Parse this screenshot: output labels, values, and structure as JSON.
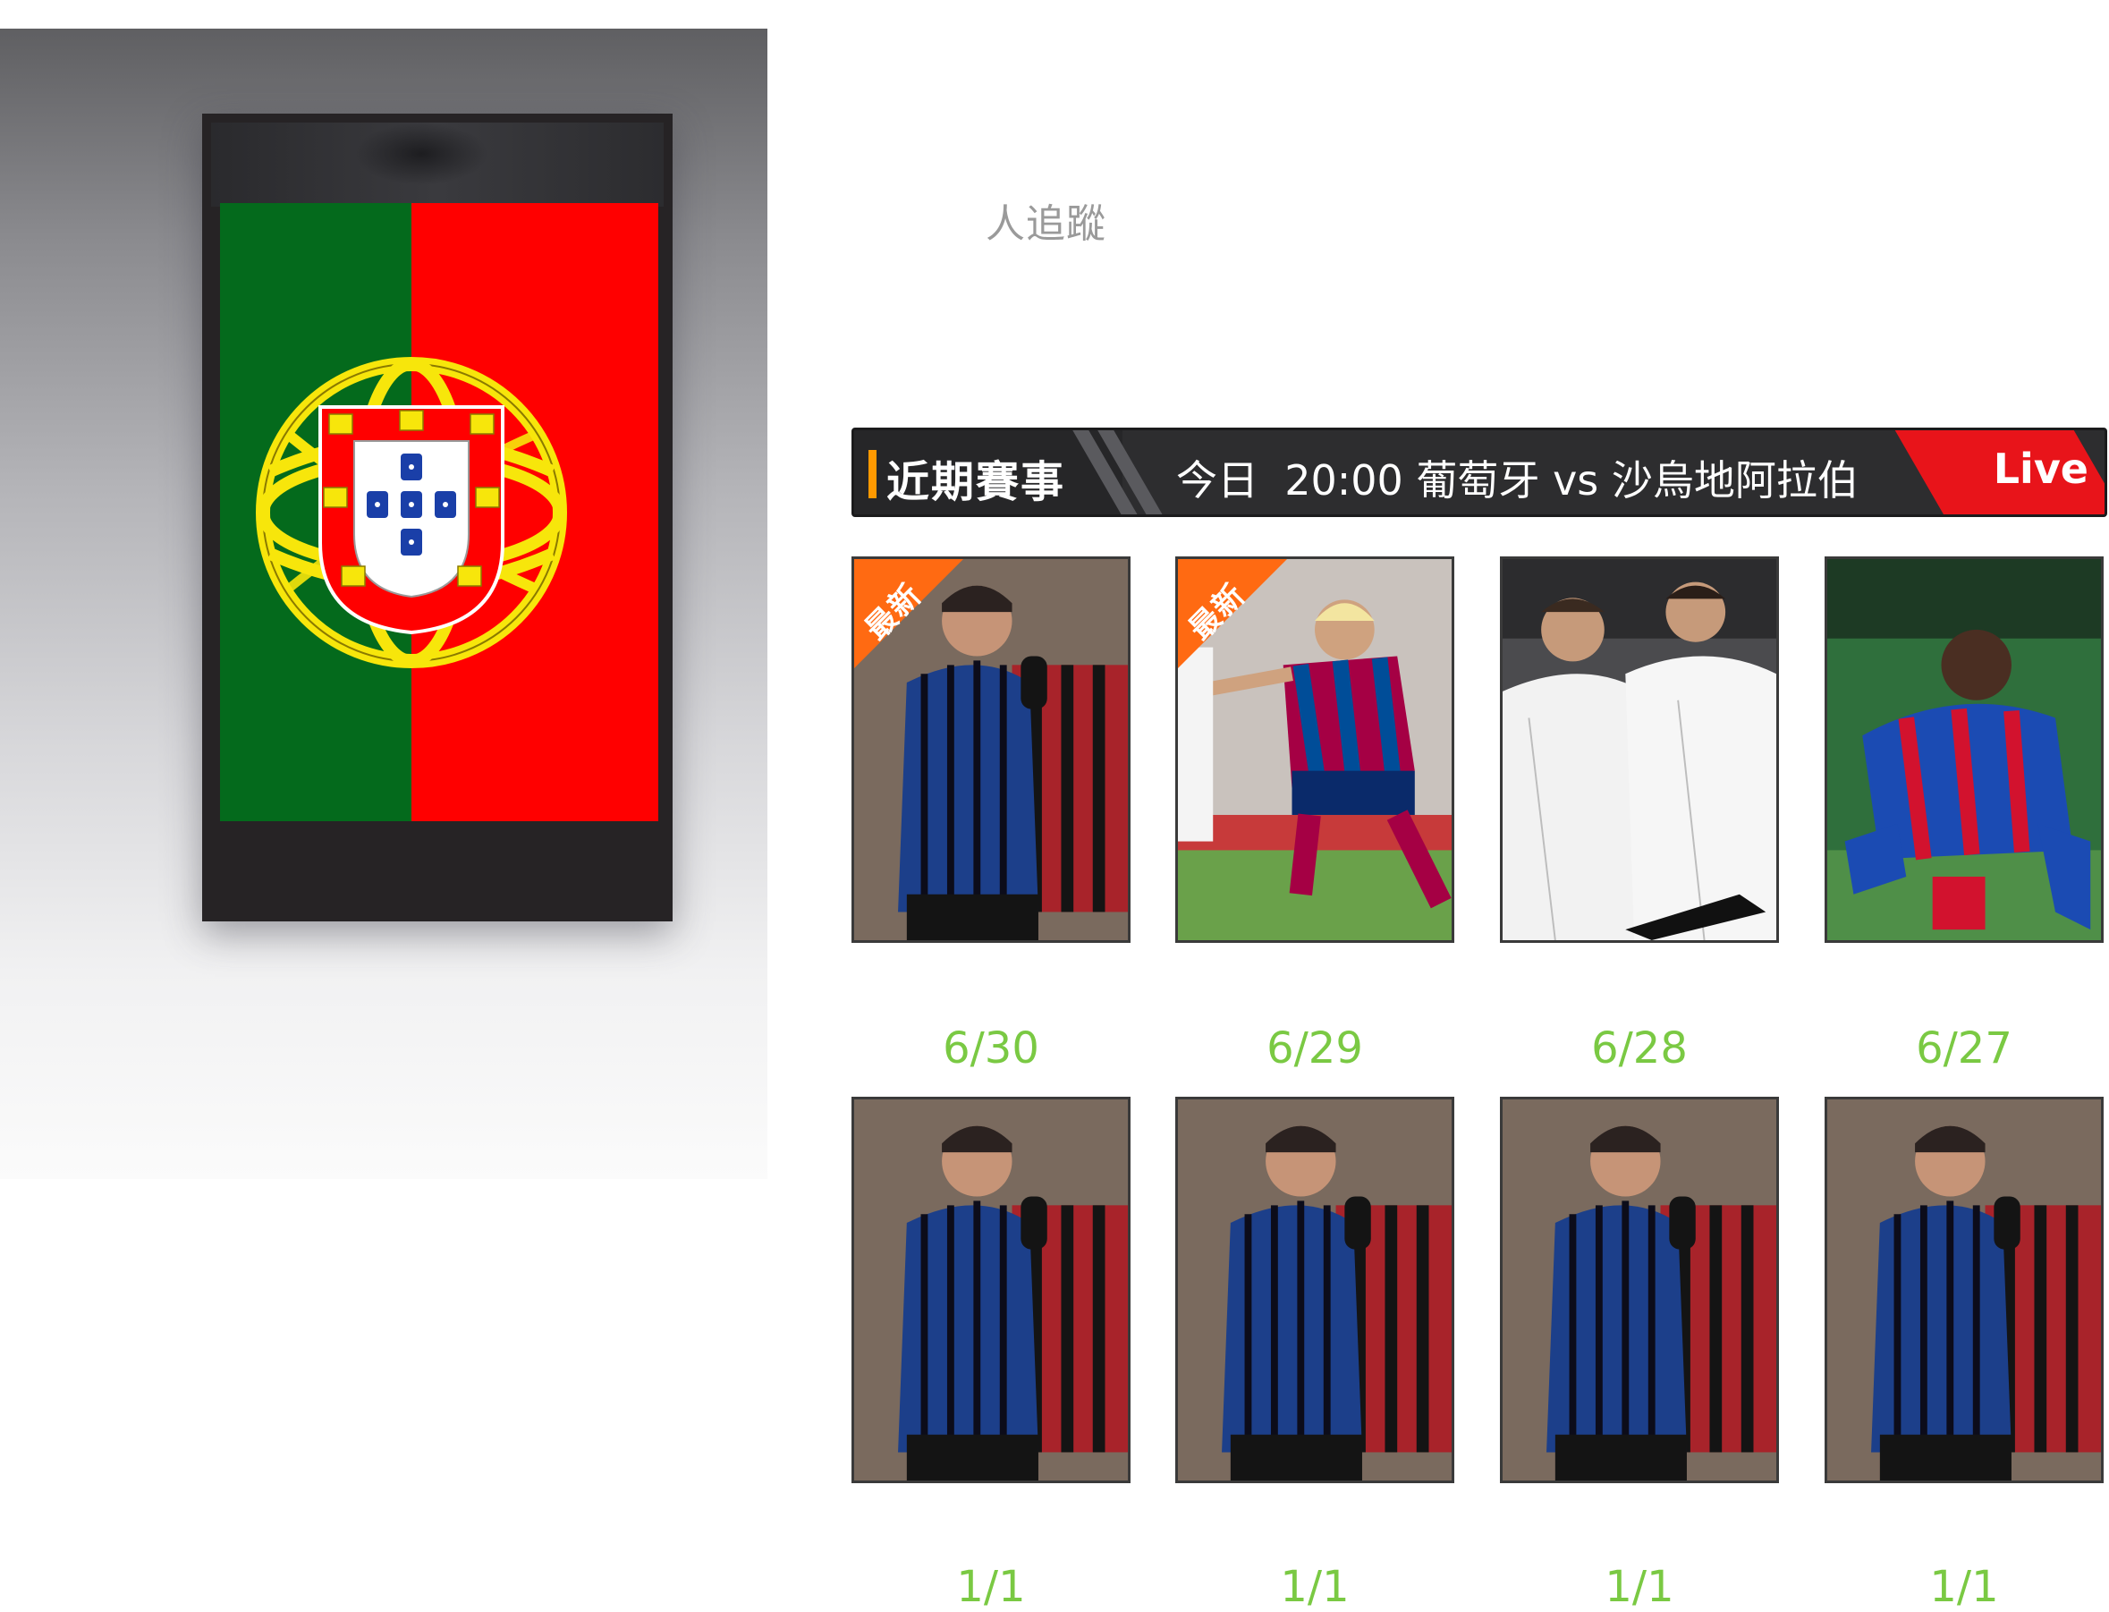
{
  "profile": {
    "followers_text": "人追蹤"
  },
  "match_bar": {
    "section_title": "近期賽事",
    "match_day": "今日",
    "match_time": "20:00",
    "home_team": "葡萄牙",
    "vs": "vs",
    "away_team": "沙烏地阿拉伯",
    "live_label": "Live"
  },
  "recent_videos": [
    {
      "badge": "最新",
      "date": "6/30"
    },
    {
      "badge": "最新",
      "date": "6/29"
    },
    {
      "badge": "",
      "date": "6/28"
    },
    {
      "badge": "",
      "date": "6/27"
    }
  ],
  "older_videos": [
    {
      "date": "1/1"
    },
    {
      "date": "1/1"
    },
    {
      "date": "1/1"
    },
    {
      "date": "1/1"
    }
  ],
  "colors": {
    "accent_orange": "#ff9900",
    "badge_orange": "#ff6a12",
    "live_red": "#e8141a",
    "date_green": "#7ac943",
    "bar_bg": "#2d2d2f",
    "flag_green": "#046a1c",
    "flag_red": "#ff0000"
  }
}
